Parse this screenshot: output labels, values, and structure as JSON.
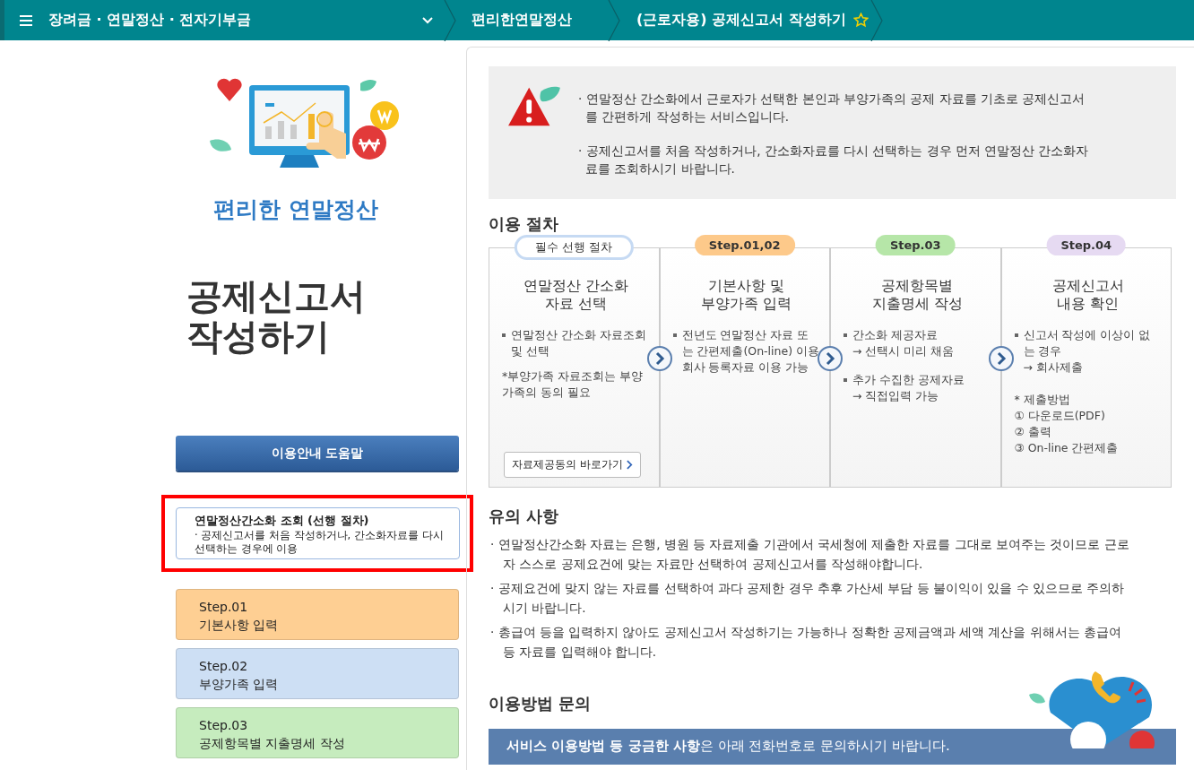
{
  "breadcrumb": [
    {
      "label": "장려금 · 연말정산 · 전자기부금",
      "kind": "menu",
      "dropdown": true
    },
    {
      "label": "편리한연말정산",
      "kind": "link"
    },
    {
      "label": "(근로자용) 공제신고서 작성하기",
      "kind": "current",
      "favorite": false
    }
  ],
  "sidebar": {
    "brand": "편리한 연말정산",
    "page_title": "공제신고서 작성하기",
    "help_button": "이용안내 도움말",
    "steps": [
      {
        "kind": "prerequisite",
        "title": "연말정산간소화 조회 (선행 절차)",
        "note": "· 공제신고서를 처음 작성하거나, 간소화자료를 다시 선택하는 경우에 이용",
        "highlighted": true
      },
      {
        "kind": "step",
        "title": "Step.01",
        "label": "기본사항 입력",
        "color": "#fecf93"
      },
      {
        "kind": "step",
        "title": "Step.02",
        "label": "부양가족 입력",
        "color": "#cddff4"
      },
      {
        "kind": "step",
        "title": "Step.03",
        "label": "공제항목별 지출명세 작성",
        "color": "#c6ecbe"
      }
    ]
  },
  "notice": [
    "· 연말정산 간소화에서 근로자가 선택한 본인과 부양가족의 공제 자료를 기초로 공제신고서를 간편하게 작성하는 서비스입니다.",
    "· 공제신고서를 처음 작성하거나, 간소화자료를 다시 선택하는 경우 먼저 연말정산 간소화자료를 조회하시기 바랍니다."
  ],
  "procedure": {
    "heading": "이용 절차",
    "cards": [
      {
        "badge": "필수 선행 절차",
        "color": "#ffffff",
        "title_lines": [
          "연말정산 간소화",
          "자료 선택"
        ],
        "lines": [
          {
            "kind": "bullet",
            "text": "연말정산 간소화 자료조회 및 선택"
          },
          {
            "kind": "note",
            "text": "*부양가족 자료조회는 부양가족의 동의 필요"
          }
        ],
        "link": "자료제공동의 바로가기"
      },
      {
        "badge": "Step.01,02",
        "color": "#fdc98a",
        "title_lines": [
          "기본사항 및",
          "부양가족 입력"
        ],
        "lines": [
          {
            "kind": "bullet",
            "text": "전년도 연말정산 자료 또는 간편제출(On-line) 이용 회사 등록자료 이용 가능"
          }
        ]
      },
      {
        "badge": "Step.03",
        "color": "#b6e6a8",
        "title_lines": [
          "공제항목별",
          "지출명세 작성"
        ],
        "lines": [
          {
            "kind": "bullet",
            "text": "간소화 제공자료"
          },
          {
            "kind": "arrow",
            "text": "→ 선택시 미리 채움"
          },
          {
            "kind": "bullet",
            "text": "추가 수집한 공제자료"
          },
          {
            "kind": "arrow",
            "text": "→ 직접입력 가능"
          }
        ]
      },
      {
        "badge": "Step.04",
        "color": "#e6daf2",
        "title_lines": [
          "공제신고서",
          "내용 확인"
        ],
        "lines": [
          {
            "kind": "bullet",
            "text": "신고서 작성에 이상이 없는 경우"
          },
          {
            "kind": "arrow",
            "text": "→ 회사제출"
          },
          {
            "kind": "note",
            "text": "* 제출방법"
          },
          {
            "kind": "item",
            "text": "① 다운로드(PDF)"
          },
          {
            "kind": "item",
            "text": "② 출력"
          },
          {
            "kind": "item",
            "text": "③ On-line 간편제출"
          }
        ]
      }
    ]
  },
  "cautions": {
    "heading": "유의 사항",
    "items": [
      "· 연말정산간소화 자료는 은행, 병원 등 자료제출 기관에서 국세청에 제출한 자료를 그대로 보여주는 것이므로 근로자 스스로 공제요건에 맞는 자료만 선택하여 공제신고서를 작성해야합니다.",
      "· 공제요건에 맞지 않는 자료를 선택하여 과다 공제한 경우 추후 가산세 부담 등 불이익이 있을 수 있으므로 주의하시기 바랍니다.",
      "· 총급여 등을 입력하지 않아도 공제신고서 작성하기는 가능하나 정확한 공제금액과 세액 계산을 위해서는 총급여 등 자료를 입력해야 합니다."
    ]
  },
  "contact": {
    "heading": "이용방법 문의",
    "banner": "**서비스 이용방법 등 궁금한 사항**은 아래 전화번호로 문의하시기 바랍니다."
  }
}
